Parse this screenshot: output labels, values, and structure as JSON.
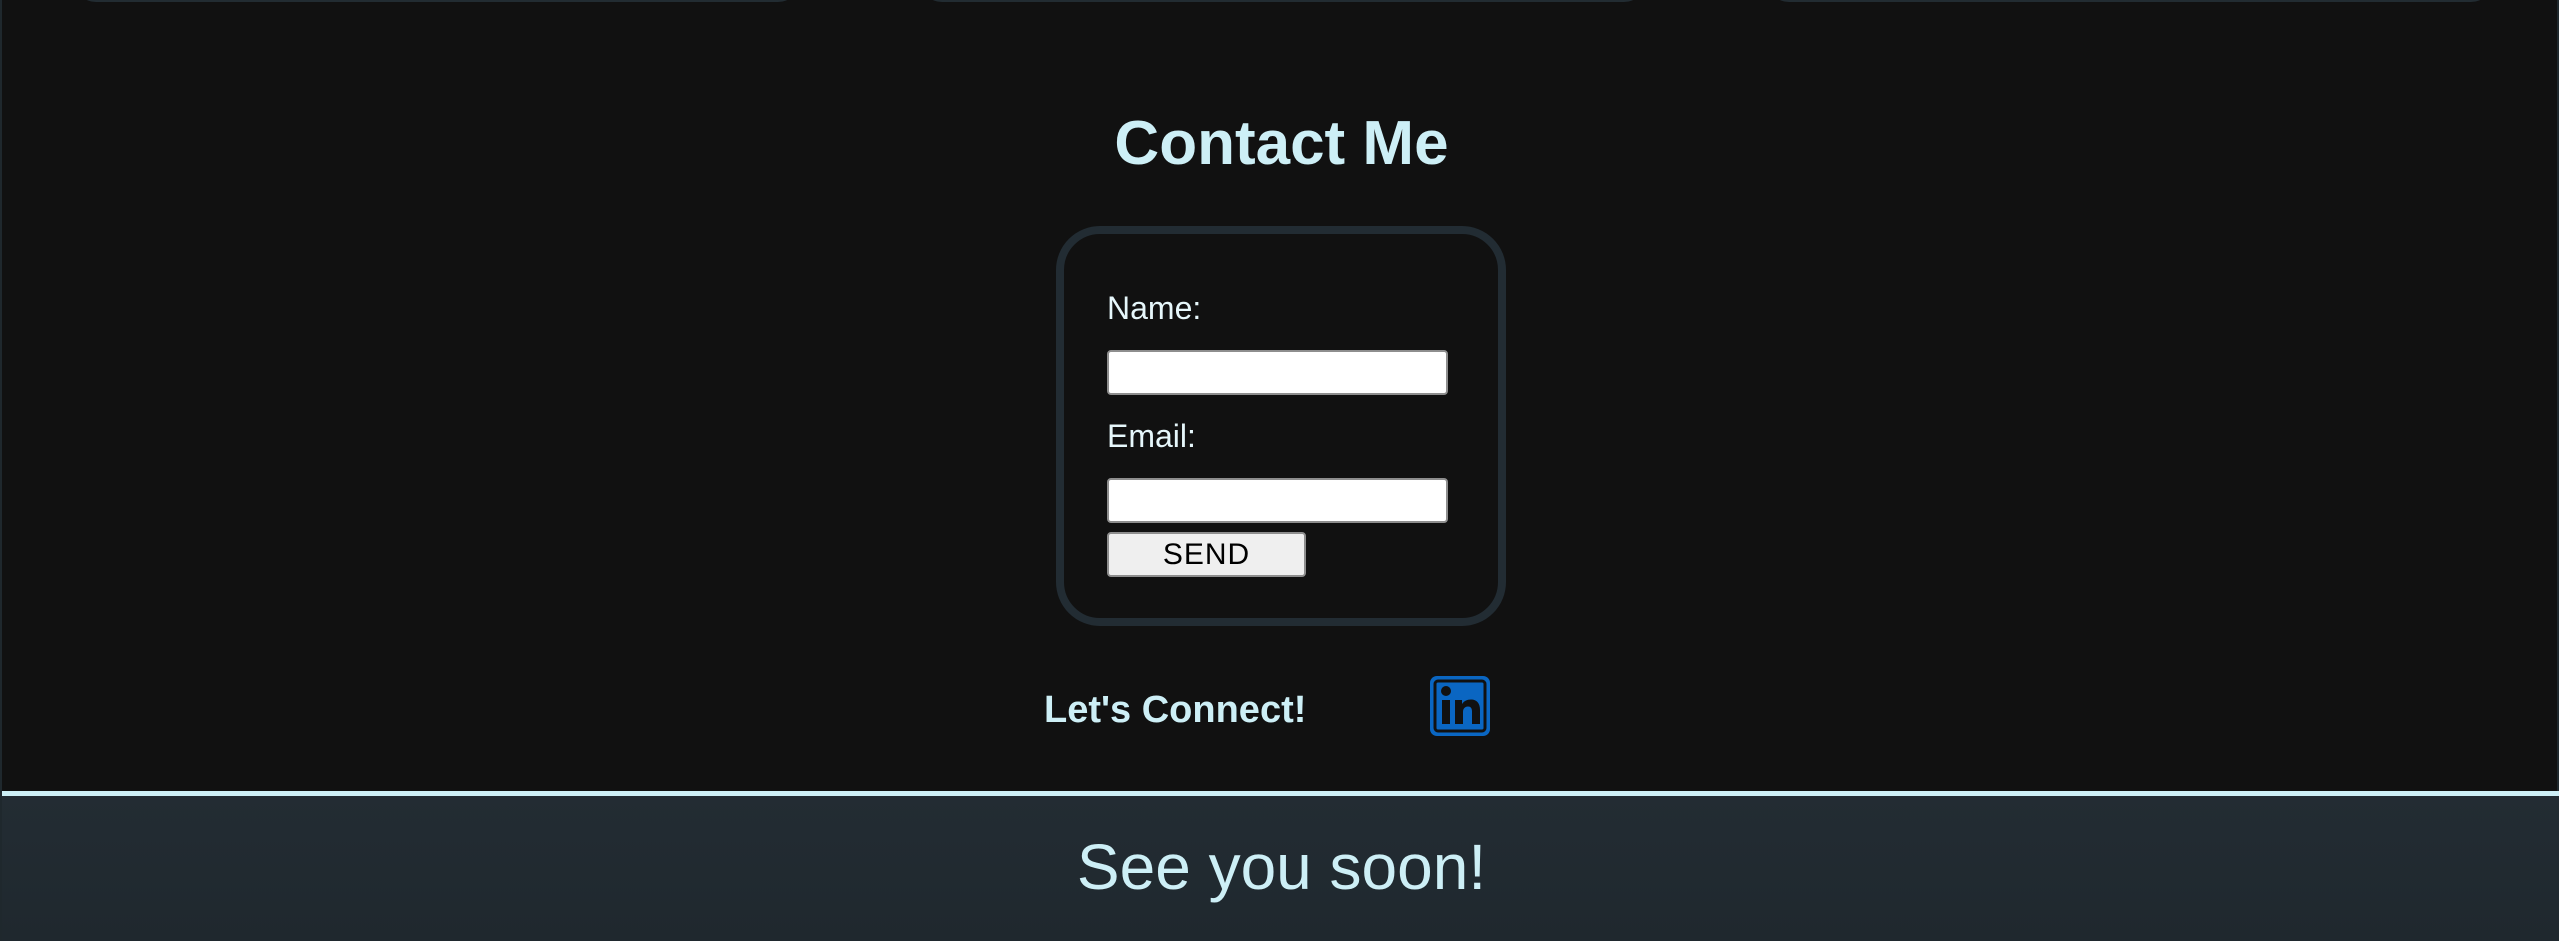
{
  "contact": {
    "title": "Contact Me",
    "name_label": "Name:",
    "name_value": "",
    "email_label": "Email:",
    "email_value": "",
    "send_label": "SEND"
  },
  "social": {
    "connect_text": "Let's Connect!",
    "linkedin_icon": "linkedin-icon",
    "linkedin_color": "#0a66c2"
  },
  "footer": {
    "text": "See you soon!"
  },
  "colors": {
    "background": "#111111",
    "accent_text": "#cdeff6",
    "panel": "#222c33"
  }
}
